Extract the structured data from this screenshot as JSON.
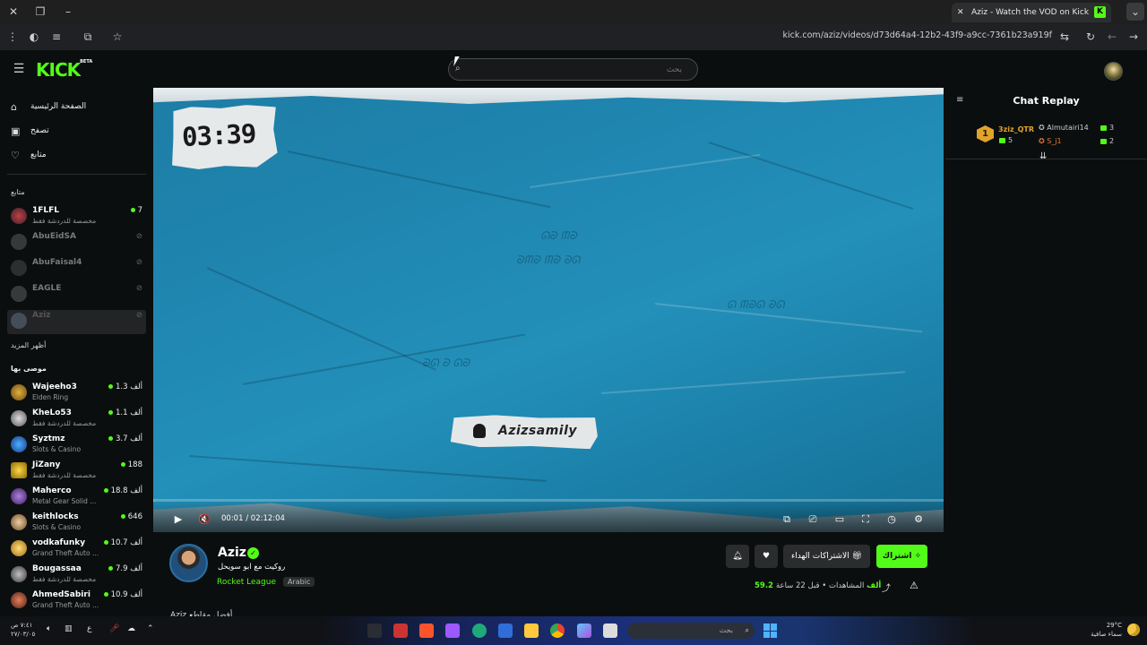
{
  "browser": {
    "tab_title": "Aziz - Watch the VOD on Kick",
    "url": "kick.com/aziz/videos/d73d64a4-12b2-43f9-a9cc-7361b23a919f"
  },
  "header": {
    "logo": "KICK",
    "logo_badge": "BETA",
    "search_placeholder": "بحث"
  },
  "sidebar": {
    "nav": [
      {
        "label": "الصفحة الرئيسية",
        "icon": "home-icon"
      },
      {
        "label": "تصفح",
        "icon": "browse-icon"
      },
      {
        "label": "متابع",
        "icon": "heart-icon"
      }
    ],
    "following_title": "متابع",
    "following": [
      {
        "name": "1FLFL",
        "sub": "مخصصة للدردشة فقط",
        "count": "7",
        "live": true
      },
      {
        "name": "AbuEidSA",
        "sub": "",
        "count": "",
        "live": false
      },
      {
        "name": "AbuFaisal4",
        "sub": "",
        "count": "",
        "live": false
      },
      {
        "name": "EAGLE",
        "sub": "",
        "count": "",
        "live": false
      },
      {
        "name": "Aziz",
        "sub": "",
        "count": "",
        "live": false
      }
    ],
    "show_more": "أظهر المزيد",
    "recommended_title": "موصى بها",
    "recommended": [
      {
        "name": "Wajeeho3",
        "sub": "Elden Ring",
        "count": "1.3 ألف"
      },
      {
        "name": "KheLo53",
        "sub": "مخصصة للدردشة فقط",
        "count": "1.1 ألف"
      },
      {
        "name": "Syztmz",
        "sub": "Slots & Casino",
        "count": "3.7 ألف"
      },
      {
        "name": "JiZany",
        "sub": "مخصصة للدردشة فقط",
        "count": "188"
      },
      {
        "name": "Maherco",
        "sub": "Metal Gear Solid ...",
        "count": "18.8 ألف"
      },
      {
        "name": "keithlocks",
        "sub": "Slots & Casino",
        "count": "646"
      },
      {
        "name": "vodkafunky",
        "sub": "Grand Theft Auto ...",
        "count": "10.7 ألف"
      },
      {
        "name": "Bougassaa",
        "sub": "مخصصة للدردشة فقط",
        "count": "7.9 ألف"
      },
      {
        "name": "AhmedSabiri",
        "sub": "Grand Theft Auto ...",
        "count": "10.9 ألف"
      }
    ]
  },
  "video": {
    "timer": "03:39",
    "handle": "Azizsamily",
    "current_time": "00:01",
    "duration": "02:12:04",
    "progress_fraction": 0.0001
  },
  "chat": {
    "title": "Chat Replay",
    "leaderboard": [
      {
        "rank": "1",
        "name": "3ziz_QTR",
        "value": "5"
      },
      {
        "name": "Almutairi14",
        "value": "3"
      },
      {
        "name": "S_j1",
        "value": "2"
      }
    ]
  },
  "channel": {
    "name": "Aziz",
    "title": "روكيت مع ابو سويحل",
    "category": "Rocket League",
    "language": "Arabic",
    "follow_label": "اشتراك",
    "gift_label": "الاشتراكات الهداء",
    "views_value": "59.2 ألف",
    "views_label": "المشاهدات",
    "time_ago": "قبل 22 ساعة",
    "cut_text": "Aziz أفضل مقاطع"
  },
  "taskbar": {
    "search_placeholder": "بحث",
    "clock_time": "٧:٤١ ص",
    "clock_date": "٢٧/٠٣/٠٥",
    "weather_temp": "29°C",
    "weather_desc": "سماء صافية",
    "lang": "ع"
  },
  "colors": {
    "kick_green": "#53fc18",
    "bg": "#0b0e0f",
    "video_blue": "#1f86b0"
  }
}
